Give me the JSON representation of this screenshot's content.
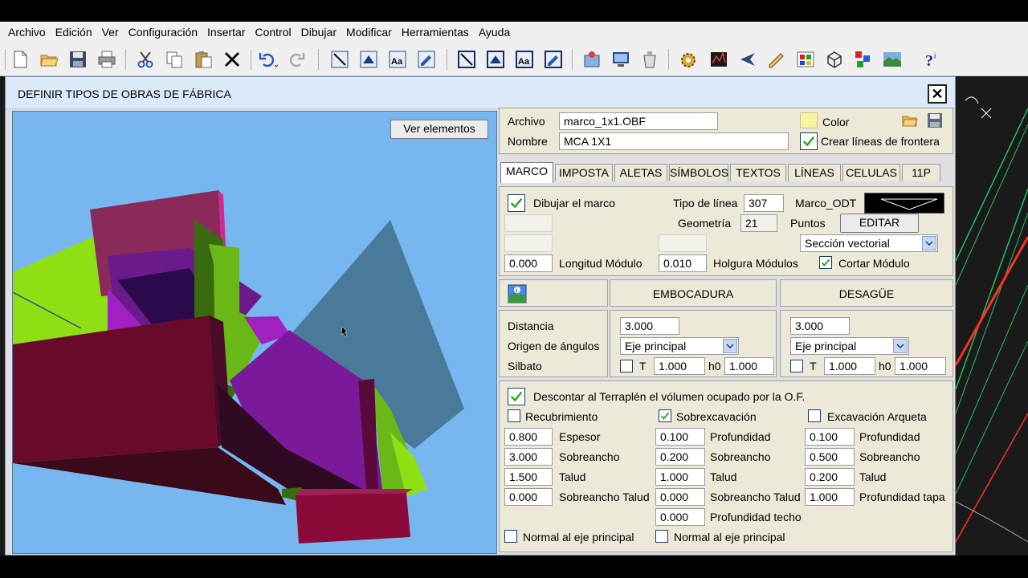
{
  "menu": [
    "Archivo",
    "Edición",
    "Ver",
    "Configuración",
    "Insertar",
    "Control",
    "Dibujar",
    "Modificar",
    "Herramientas",
    "Ayuda"
  ],
  "dialog": {
    "title": "DEFINIR TIPOS DE OBRAS DE FÁBRICA",
    "view_button": "Ver elementos"
  },
  "file": {
    "archivo_label": "Archivo",
    "archivo_value": "marco_1x1.OBF",
    "nombre_label": "Nombre",
    "nombre_value": "MCA 1X1",
    "color_label": "Color",
    "crear_label": "Crear líneas de frontera"
  },
  "tabs": [
    "MARCO",
    "IMPOSTA",
    "ALETAS",
    "SÍMBOLOS",
    "TEXTOS",
    "LÍNEAS",
    "CELULAS",
    "11P"
  ],
  "marco": {
    "dibujar_label": "Dibujar el marco",
    "tipo_linea_label": "Tipo de línea",
    "tipo_linea_value": "307",
    "marco_odt": "Marco_ODT",
    "geometria_label": "Geometría",
    "geometria_value": "21",
    "puntos_label": "Puntos",
    "editar_button": "EDITAR",
    "seccion_value": "Sección vectorial",
    "longitud_value": "0.000",
    "longitud_label": "Longitud Módulo",
    "holgura_value": "0.010",
    "holgura_label": "Holgura Módulos",
    "cortar_label": "Cortar Módulo"
  },
  "ends": {
    "embocadura": "EMBOCADURA",
    "desague": "DESAGÜE",
    "distancia_label": "Distancia",
    "origen_label": "Origen de ángulos",
    "silbato_label": "Silbato",
    "emb_distancia": "3.000",
    "emb_origen": "Eje principal",
    "emb_t": "1.000",
    "emb_h0": "1.000",
    "des_distancia": "3.000",
    "des_origen": "Eje principal",
    "des_t": "1.000",
    "des_h0": "1.000",
    "t_label": "T",
    "h0_label": "h0"
  },
  "volume": {
    "descontar_label": "Descontar al Terraplén el vólumen ocupado por la O.F.",
    "recubrimiento_label": "Recubrimiento",
    "rec_espesor": "0.800",
    "rec_sobreancho": "3.000",
    "rec_talud": "1.500",
    "rec_sobreancho_talud": "0.000",
    "espesor_label": "Espesor",
    "sobreancho_label": "Sobreancho",
    "talud_label": "Talud",
    "sobreancho_talud_label": "Sobreancho Talud",
    "sobrex_label": "Sobrexcavación",
    "sob_profundidad": "0.100",
    "sob_sobreancho": "0.200",
    "sob_talud": "1.000",
    "sob_sobreancho_talud": "0.000",
    "sob_profundidad_techo": "0.000",
    "profundidad_label": "Profundidad",
    "profundidad_techo_label": "Profundidad techo",
    "arqueta_label": "Excavación Arqueta",
    "arq_profundidad": "0.100",
    "arq_sobreancho": "0.500",
    "arq_talud": "0.200",
    "arq_profundidad_tapa": "1.000",
    "profundidad_tapa_label": "Profundidad tapa",
    "normal_label": "Normal al eje principal"
  },
  "colors": {
    "viewport_bg": "#78b6f0",
    "checkbox_green": "#1aa21a"
  }
}
